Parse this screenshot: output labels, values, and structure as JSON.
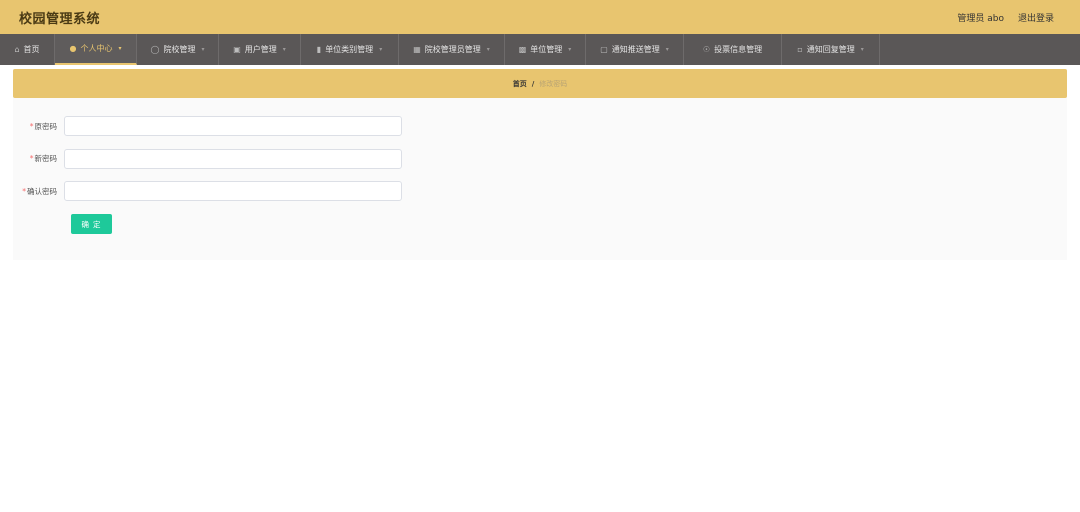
{
  "header": {
    "title": "校园管理系统",
    "user_label": "管理员 abo",
    "logout_label": "退出登录"
  },
  "nav": {
    "items": [
      {
        "label": "首页",
        "icon": "home-icon",
        "active": false,
        "dropdown": false
      },
      {
        "label": "个人中心",
        "icon": "user-icon",
        "active": true,
        "dropdown": true
      },
      {
        "label": "院校管理",
        "icon": "circle-icon",
        "active": false,
        "dropdown": true
      },
      {
        "label": "用户管理",
        "icon": "chat-icon",
        "active": false,
        "dropdown": true
      },
      {
        "label": "单位类别管理",
        "icon": "bar-chart-icon",
        "active": false,
        "dropdown": true
      },
      {
        "label": "院校管理员管理",
        "icon": "building-icon",
        "active": false,
        "dropdown": true
      },
      {
        "label": "单位管理",
        "icon": "monitor-icon",
        "active": false,
        "dropdown": true
      },
      {
        "label": "通知推送管理",
        "icon": "image-icon",
        "active": false,
        "dropdown": true
      },
      {
        "label": "投票信息管理",
        "icon": "compass-icon",
        "active": false,
        "dropdown": false
      },
      {
        "label": "通知回复管理",
        "icon": "clipboard-icon",
        "active": false,
        "dropdown": true
      }
    ]
  },
  "breadcrumb": {
    "home": "首页",
    "separator": "/",
    "current": "修改密码"
  },
  "form": {
    "old_password_label": "原密码",
    "new_password_label": "新密码",
    "confirm_password_label": "确认密码",
    "required_mark": "*",
    "old_password_value": "",
    "new_password_value": "",
    "confirm_password_value": "",
    "submit_label": "确 定"
  },
  "colors": {
    "header_bg": "#e8c56f",
    "nav_bg": "#5a5757",
    "accent": "#e8c56f",
    "button": "#1ec99a"
  }
}
